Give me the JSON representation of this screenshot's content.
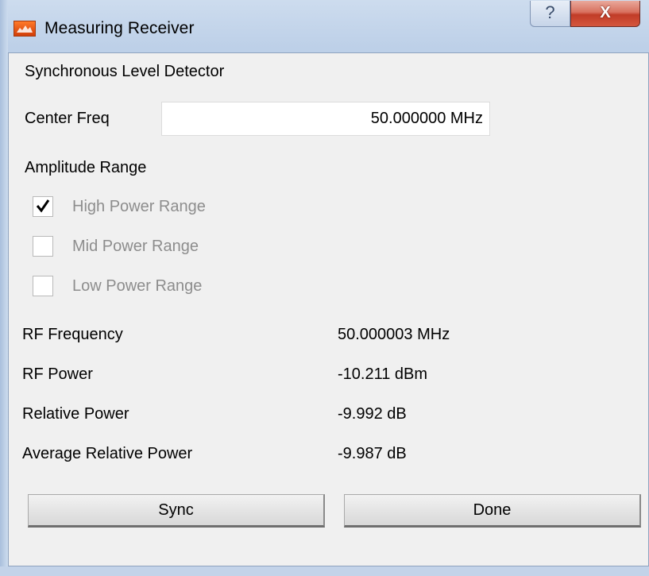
{
  "window": {
    "title": "Measuring Receiver",
    "help_glyph": "?",
    "close_glyph": "X"
  },
  "dialog": {
    "section_title": "Synchronous Level Detector",
    "center_freq_label": "Center Freq",
    "center_freq_value": "50.000000 MHz",
    "amplitude_range_label": "Amplitude Range",
    "ranges": [
      {
        "label": "High Power Range",
        "checked": true
      },
      {
        "label": "Mid Power Range",
        "checked": false
      },
      {
        "label": "Low Power Range",
        "checked": false
      }
    ],
    "readouts": [
      {
        "label": "RF Frequency",
        "value": "50.000003 MHz"
      },
      {
        "label": "RF Power",
        "value": "-10.211 dBm"
      },
      {
        "label": "Relative Power",
        "value": "-9.992 dB"
      },
      {
        "label": "Average Relative Power",
        "value": "-9.987 dB"
      }
    ],
    "buttons": {
      "sync": "Sync",
      "done": "Done"
    }
  },
  "colors": {
    "close_button": "#c13c27",
    "disabled_text": "#8d8d8d",
    "panel_bg": "#f0f0f0"
  }
}
